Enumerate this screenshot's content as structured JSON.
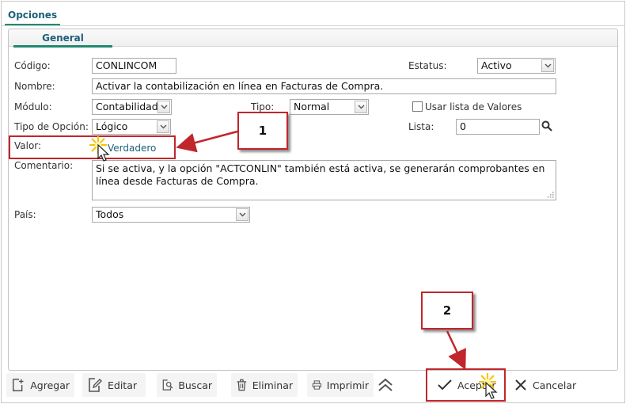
{
  "tabs": {
    "main": "Opciones",
    "sub": "General"
  },
  "form": {
    "codigo": {
      "label": "Código:",
      "value": "CONLINCOM"
    },
    "estatus": {
      "label": "Estatus:",
      "value": "Activo"
    },
    "nombre": {
      "label": "Nombre:",
      "value": "Activar la contabilización en línea en Facturas de Compra."
    },
    "modulo": {
      "label": "Módulo:",
      "value": "Contabilidad"
    },
    "tipo": {
      "label": "Tipo:",
      "value": "Normal"
    },
    "usar_lista": {
      "label": "Usar lista de Valores",
      "checked": false
    },
    "tipo_opcion": {
      "label": "Tipo de Opción:",
      "value": "Lógico"
    },
    "lista": {
      "label": "Lista:",
      "value": "0"
    },
    "valor": {
      "label": "Valor:",
      "value": "Verdadero"
    },
    "comentario": {
      "label": "Comentario:",
      "value": "Si se activa, y la opción \"ACTCONLIN\" también está activa, se generarán comprobantes en línea desde Facturas de Compra."
    },
    "pais": {
      "label": "País:",
      "value": "Todos"
    }
  },
  "toolbar": {
    "agregar": "Agregar",
    "editar": "Editar",
    "buscar": "Buscar",
    "eliminar": "Eliminar",
    "imprimir": "Imprimir",
    "aceptar": "Aceptar",
    "cancelar": "Cancelar"
  },
  "annotations": {
    "callout1": "1",
    "callout2": "2"
  },
  "colors": {
    "accent": "#1f8a70",
    "tab_text": "#1c5f7a",
    "annotation_red": "#c0262b"
  }
}
